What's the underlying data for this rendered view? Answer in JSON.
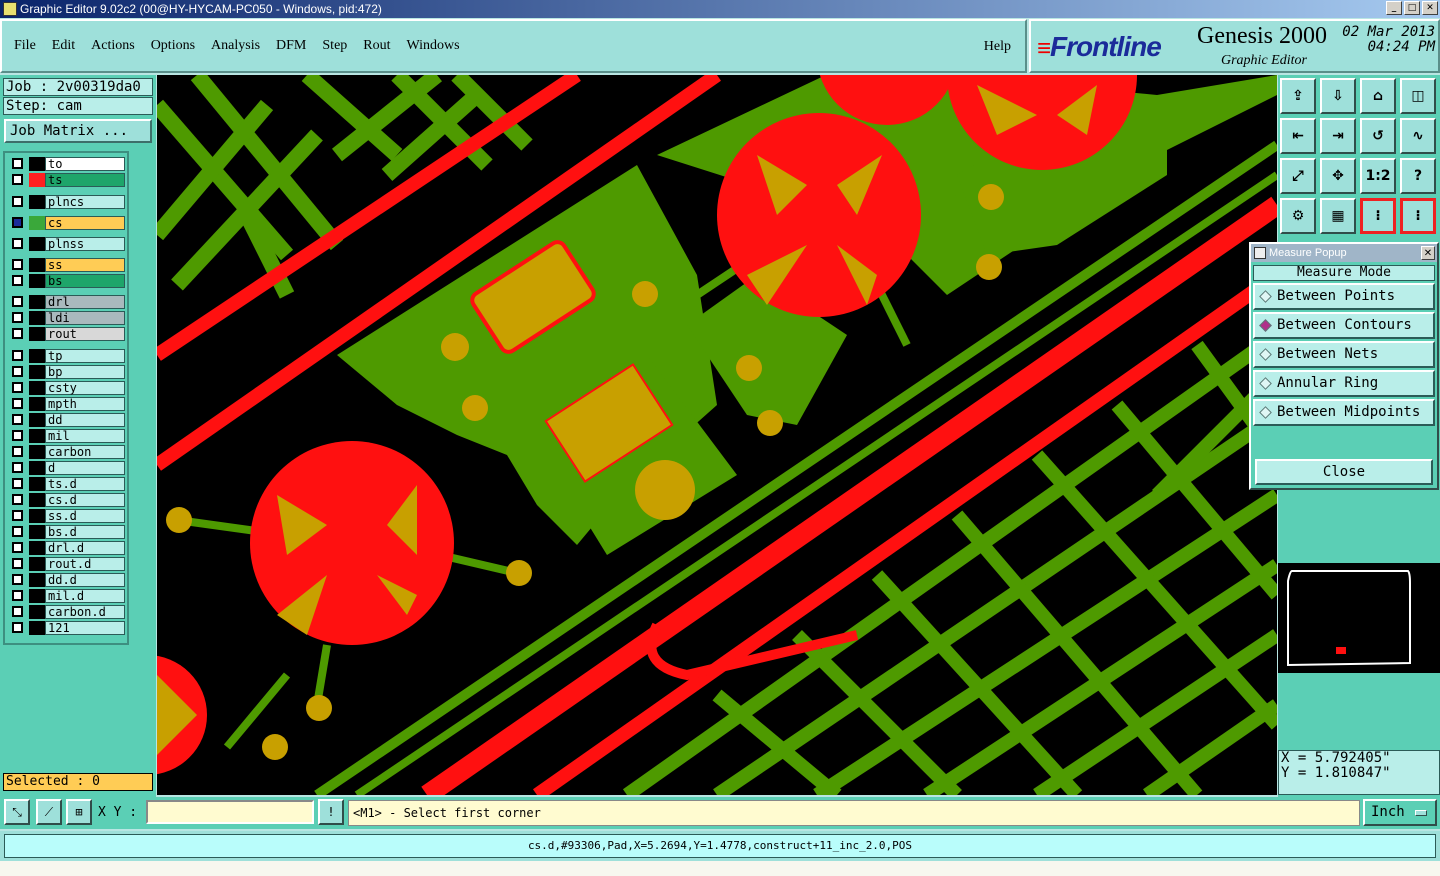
{
  "window": {
    "title": "Graphic Editor 9.02c2 (00@HY-HYCAM-PC050 - Windows, pid:472)",
    "min": "_",
    "max": "□",
    "close": "✕"
  },
  "menu": [
    "File",
    "Edit",
    "Actions",
    "Options",
    "Analysis",
    "DFM",
    "Step",
    "Rout",
    "Windows"
  ],
  "help": "Help",
  "brand": {
    "logo": "Frontline",
    "product": "Genesis 2000",
    "module": "Graphic Editor",
    "date": "02 Mar 2013",
    "time": "04:24 PM"
  },
  "job": {
    "job": "Job : 2v00319da0",
    "step": "Step: cam",
    "matrix": "Job Matrix ..."
  },
  "layers": [
    {
      "name": "to",
      "color": "#000000",
      "bg": "#ffffff"
    },
    {
      "name": "ts",
      "color": "#ff2020",
      "bg": "#1ea56a",
      "edit": true
    },
    {
      "name": "plncs",
      "color": "#000000",
      "bg": "#b9eee9"
    },
    {
      "name": "cs",
      "color": "#3aa83a",
      "bg": "#ffcc55",
      "edit": true,
      "active": true
    },
    {
      "name": "plnss",
      "color": "#000000",
      "bg": "#b9eee9"
    },
    {
      "name": "ss",
      "color": "#000000",
      "bg": "#ffcc55",
      "edit": true
    },
    {
      "name": "bs",
      "color": "#000000",
      "bg": "#1ea56a",
      "edit": true
    },
    {
      "name": "drl",
      "color": "#000000",
      "bg": "#a9b9bd"
    },
    {
      "name": "ldi",
      "color": "#000000",
      "bg": "#a9b9bd"
    },
    {
      "name": "rout",
      "color": "#000000",
      "bg": "#d8d8d8"
    },
    {
      "name": "tp",
      "color": "#000000",
      "bg": "#b9eee9"
    },
    {
      "name": "bp",
      "color": "#000000",
      "bg": "#b9eee9"
    },
    {
      "name": "csty",
      "color": "#000000",
      "bg": "#b9eee9"
    },
    {
      "name": "mpth",
      "color": "#000000",
      "bg": "#b9eee9"
    },
    {
      "name": "dd",
      "color": "#000000",
      "bg": "#b9eee9",
      "edit": true
    },
    {
      "name": "mil",
      "color": "#000000",
      "bg": "#b9eee9"
    },
    {
      "name": "carbon",
      "color": "#000000",
      "bg": "#b9eee9",
      "edit": true
    },
    {
      "name": "d",
      "color": "#000000",
      "bg": "#b9eee9"
    },
    {
      "name": "ts.d",
      "color": "#000000",
      "bg": "#b9eee9",
      "edit": true
    },
    {
      "name": "cs.d",
      "color": "#000000",
      "bg": "#b9eee9",
      "edit": true
    },
    {
      "name": "ss.d",
      "color": "#000000",
      "bg": "#b9eee9",
      "edit": true
    },
    {
      "name": "bs.d",
      "color": "#000000",
      "bg": "#b9eee9",
      "edit": true
    },
    {
      "name": "drl.d",
      "color": "#000000",
      "bg": "#b9eee9"
    },
    {
      "name": "rout.d",
      "color": "#000000",
      "bg": "#b9eee9"
    },
    {
      "name": "dd.d",
      "color": "#000000",
      "bg": "#b9eee9",
      "edit": true
    },
    {
      "name": "mil.d",
      "color": "#000000",
      "bg": "#b9eee9"
    },
    {
      "name": "carbon.d",
      "color": "#000000",
      "bg": "#b9eee9",
      "edit": true
    },
    {
      "name": "121",
      "color": "#000000",
      "bg": "#b9eee9"
    }
  ],
  "selected": "Selected : 0",
  "toolbar": [
    "home-icon",
    "save-icon",
    "house-icon",
    "split-icon",
    "zoom-left-icon",
    "zoom-right-icon",
    "rotate-icon",
    "wave-icon",
    "fit-icon",
    "center-icon",
    "scale-icon",
    "question-icon",
    "tools-icon",
    "grid-icon",
    "snap-red-icon",
    "snap-red2-icon"
  ],
  "toolbar_text": {
    "scale": "1:2",
    "question": "?"
  },
  "measure": {
    "title": "Measure Popup",
    "mode_label": "Measure Mode",
    "options": [
      {
        "label": "Between Points",
        "selected": false
      },
      {
        "label": "Between Contours",
        "selected": true
      },
      {
        "label": "Between Nets",
        "selected": false
      },
      {
        "label": "Annular Ring",
        "selected": false
      },
      {
        "label": "Between Midpoints",
        "selected": false
      }
    ],
    "close": "Close"
  },
  "coords": {
    "x": "X = 5.792405\"",
    "y": "Y = 1.810847\""
  },
  "xy_label": "X Y :",
  "xy_value": "",
  "alert": "!",
  "prompt": "<M1> - Select first corner",
  "unit": "Inch",
  "status": "cs.d,#93306,Pad,X=5.2694,Y=1.4778,construct+11_inc_2.0,POS",
  "colors": {
    "green": "#4e9a00",
    "red": "#ff1010",
    "yellow": "#c8a000",
    "bg": "#000000",
    "panel": "#5bcfb5"
  }
}
